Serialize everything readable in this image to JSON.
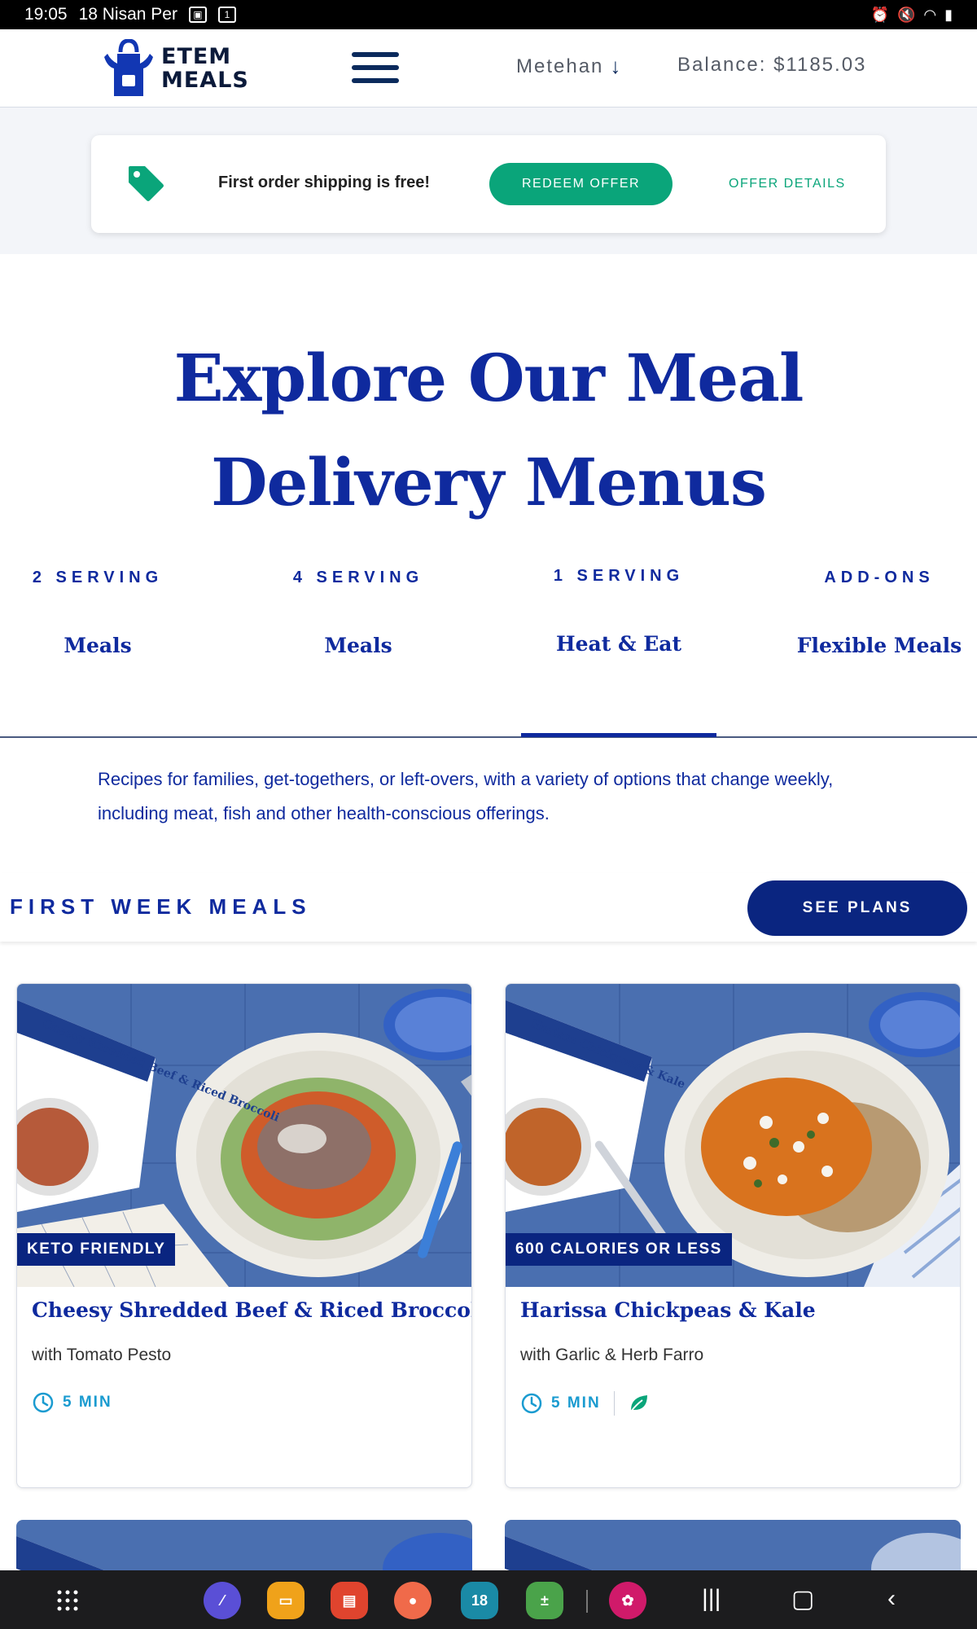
{
  "status_bar": {
    "time": "19:05",
    "date": "18 Nisan Per",
    "notif_badge": "1"
  },
  "header": {
    "logo_line1": "ETEM",
    "logo_line2": "MEALS",
    "user_name": "Metehan",
    "user_arrow": "↓",
    "balance": "Balance: $1185.03"
  },
  "offer": {
    "text": "First order shipping is free!",
    "redeem_label": "REDEEM OFFER",
    "details_label": "OFFER DETAILS"
  },
  "headline": "Explore Our Meal Delivery Menus",
  "tabs": [
    {
      "top": "2 SERVING",
      "bottom": "Meals"
    },
    {
      "top": "4 SERVING",
      "bottom": "Meals"
    },
    {
      "top": "1 SERVING",
      "bottom": "Heat & Eat"
    },
    {
      "top": "ADD-ONS",
      "bottom": "Flexible Meals"
    }
  ],
  "active_tab_index": 2,
  "description": "Recipes for families, get-togethers, or left-overs, with a variety of options that change weekly, including meat, fish and other health-conscious offerings.",
  "first_week": {
    "title": "FIRST WEEK MEALS",
    "button_label": "SEE PLANS"
  },
  "meals": [
    {
      "badge": "KETO FRIENDLY",
      "title": "Cheesy Shredded Beef & Riced Broccoli",
      "subtitle": "with Tomato Pesto",
      "time": "5 MIN",
      "vegetarian": false,
      "package_text": "Cheesy Shredded Beef & Riced Broccoli"
    },
    {
      "badge": "600 CALORIES OR LESS",
      "title": "Harissa Chickpeas & Kale",
      "subtitle": "with Garlic & Herb Farro",
      "time": "5 MIN",
      "vegetarian": true,
      "package_text": "Harissa Chickpeas & Kale"
    }
  ],
  "nav": {
    "calendar_day": "18"
  },
  "colors": {
    "brand_blue": "#0f2a9e",
    "navy": "#0a2580",
    "green": "#0aa57a",
    "time_blue": "#1a9bd0"
  }
}
